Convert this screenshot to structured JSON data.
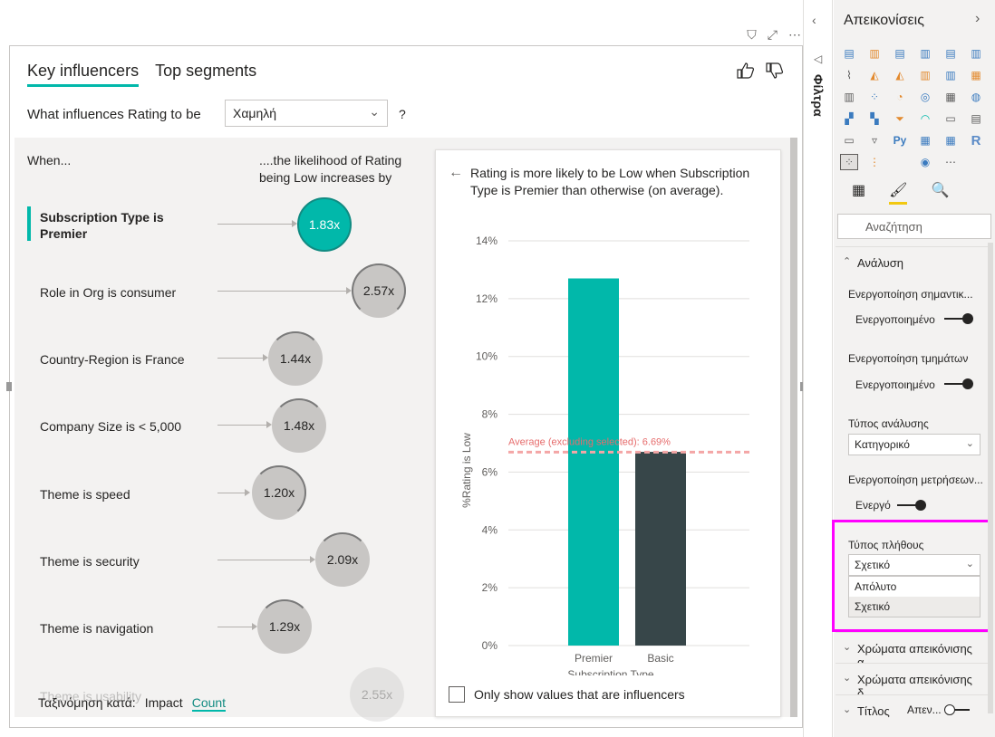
{
  "visual": {
    "tabs": [
      "Key influencers",
      "Top segments"
    ],
    "question_prefix": "What influences Rating to be",
    "question_value": "Χαμηλή",
    "question_help": "?",
    "col_when": "When...",
    "col_likelihood": "....the likelihood of Rating being Low increases by",
    "influencers": [
      {
        "label": "Subscription Type is Premier",
        "value": "1.83x"
      },
      {
        "label": "Role in Org is consumer",
        "value": "2.57x"
      },
      {
        "label": "Country-Region is France",
        "value": "1.44x"
      },
      {
        "label": "Company Size is < 5,000",
        "value": "1.48x"
      },
      {
        "label": "Theme is speed",
        "value": "1.20x"
      },
      {
        "label": "Theme is security",
        "value": "2.09x"
      },
      {
        "label": "Theme is navigation",
        "value": "1.29x"
      },
      {
        "label": "Theme is usability",
        "value": "2.55x"
      }
    ],
    "sort_by": "Ταξινόμηση κατά:",
    "sort_impact": "Impact",
    "sort_count": "Count"
  },
  "card": {
    "title": "Rating is more likely to be Low when Subscription Type is Premier than otherwise (on average).",
    "checkbox_label": "Only show values that are influencers"
  },
  "chart_data": {
    "type": "bar",
    "categories": [
      "Premier",
      "Basic"
    ],
    "values": [
      12.7,
      6.7
    ],
    "colors": [
      "#01b8aa",
      "#374649"
    ],
    "xlabel": "Subscription Type",
    "ylabel": "%Rating is Low",
    "ylim": [
      0,
      14
    ],
    "yticks": [
      "0%",
      "2%",
      "4%",
      "6%",
      "8%",
      "10%",
      "12%",
      "14%"
    ],
    "reference_line": {
      "label": "Average (excluding selected): 6.69%",
      "value": 6.69
    }
  },
  "filters": {
    "label": "Φίλτρα"
  },
  "viz_pane": {
    "title": "Απεικονίσεις",
    "search_placeholder": "Αναζήτηση",
    "section_analysis": "Ανάλυση",
    "enable_key": "Ενεργοποίηση σημαντικ...",
    "enable_key_val": "Ενεργοποιημένο",
    "enable_segments": "Ενεργοποίηση τμημάτων",
    "enable_segments_val": "Ενεργοποιημένο",
    "analysis_type": "Τύπος ανάλυσης",
    "analysis_type_val": "Κατηγορικό",
    "enable_measures": "Ενεργοποίηση μετρήσεων...",
    "enable_measures_val": "Ενεργό",
    "count_type": "Τύπος πλήθους",
    "count_type_val": "Σχετικό",
    "count_options": [
      "Απόλυτο",
      "Σχετικό"
    ],
    "section_colors1": "Χρώματα απεικόνισης α...",
    "section_colors2": "Χρώματα απεικόνισης δ...",
    "section_title": "Τίτλος",
    "section_title_val": "Απεν..."
  }
}
